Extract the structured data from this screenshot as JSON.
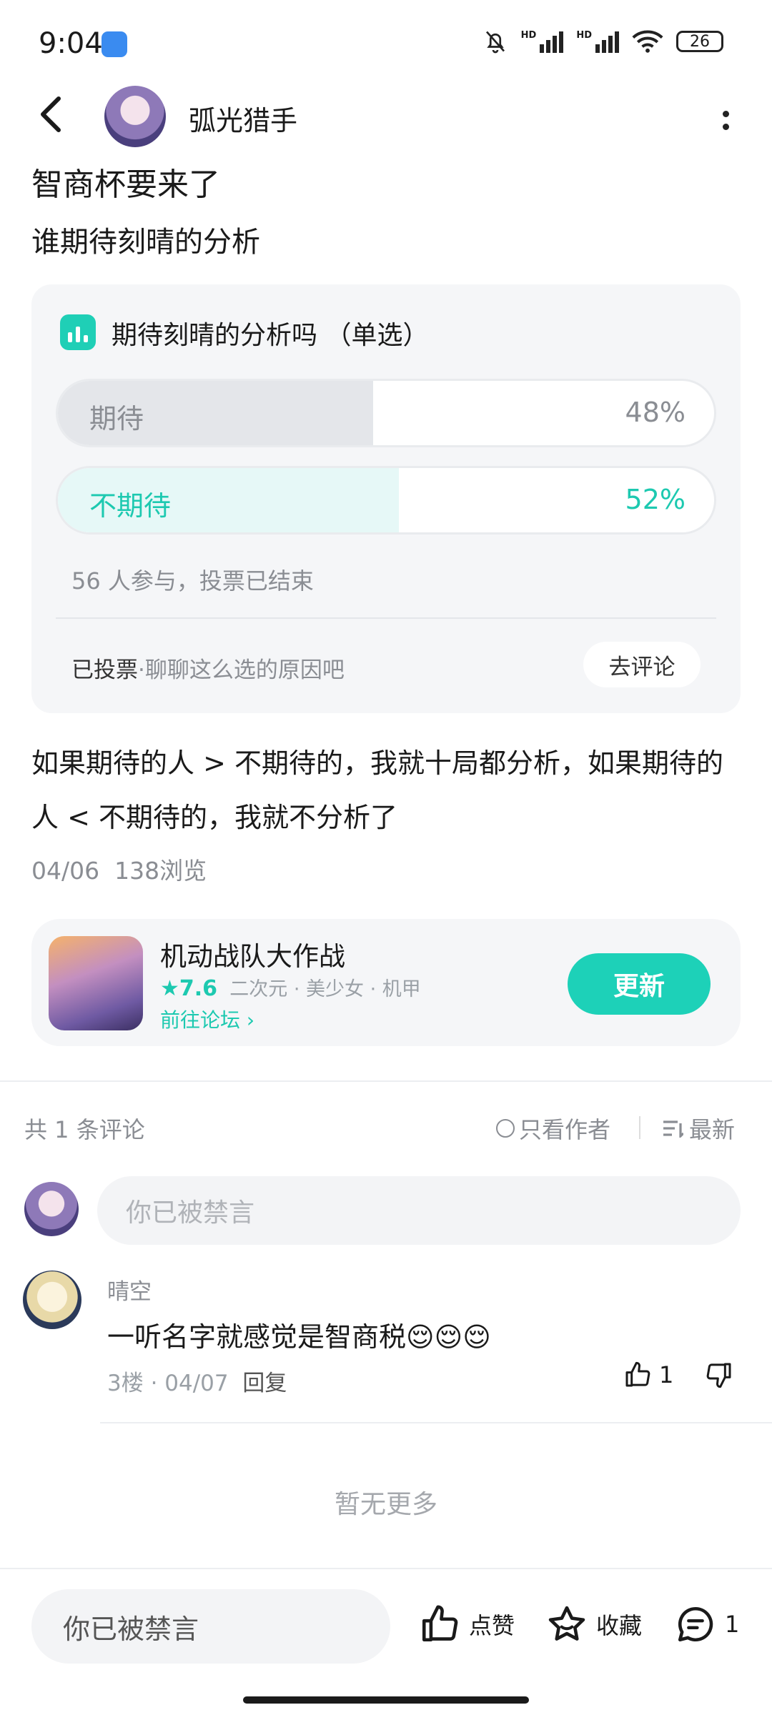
{
  "status": {
    "time": "9:04",
    "battery": "26",
    "hd": "HD"
  },
  "header": {
    "author": "弧光猎手"
  },
  "post": {
    "title": "智商杯要来了",
    "subtitle": "谁期待刻晴的分析",
    "body": "如果期待的人 > 不期待的，我就十局都分析，如果期待的人 < 不期待的，我就不分析了",
    "date": "04/06",
    "views": "138浏览"
  },
  "poll": {
    "title": "期待刻晴的分析吗  （单选）",
    "options": [
      {
        "label": "期待",
        "percent": "48%",
        "value": 48
      },
      {
        "label": "不期待",
        "percent": "52%",
        "value": 52
      }
    ],
    "meta": "56 人参与，投票已结束",
    "voted": "已投票",
    "voted_hint": "·聊聊这么选的原因吧",
    "comment_button": "去评论"
  },
  "game": {
    "name": "机动战队大作战",
    "rating": "7.6",
    "tags": "二次元 · 美少女 · 机甲",
    "forum_link": "前往论坛",
    "update_button": "更新"
  },
  "comments_section": {
    "count": "共 1 条评论",
    "only_author": "只看作者",
    "newest": "最新",
    "input_placeholder": "你已被禁言"
  },
  "comments": [
    {
      "name": "晴空",
      "text": "一听名字就感觉是智商税😌😌😌",
      "floor_date": "3楼 · 04/07",
      "reply": "回复",
      "likes": "1"
    }
  ],
  "no_more": "暂无更多",
  "bottom_bar": {
    "input": "你已被禁言",
    "like": "点赞",
    "favorite": "收藏",
    "comments": "1"
  }
}
